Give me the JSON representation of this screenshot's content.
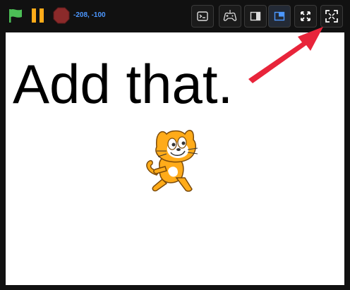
{
  "toolbar": {
    "green_flag_icon": "green-flag-icon",
    "pause_icon": "pause-icon",
    "stop_icon": "stop-sign-icon",
    "coords": "-208, -100",
    "buttons": [
      {
        "name": "addons-button",
        "icon": "terminal-icon"
      },
      {
        "name": "gamepad-button",
        "icon": "gamepad-icon"
      },
      {
        "name": "small-stage-button",
        "icon": "small-stage-icon"
      },
      {
        "name": "normal-stage-button",
        "icon": "normal-stage-icon"
      },
      {
        "name": "fullscreen-button",
        "icon": "fullscreen-icon"
      },
      {
        "name": "browser-fullscreen-button",
        "icon": "expand-icon"
      }
    ]
  },
  "stage": {
    "text": "Add that.",
    "sprite": "scratch-cat-sprite"
  },
  "colors": {
    "toolbar_bg": "#111111",
    "stage_bg": "#ffffff",
    "coords": "#4c97ff",
    "flag": "#4cbf56",
    "pause": "#ffab19",
    "stop": "#8b2a2a",
    "arrow": "#e8243a"
  }
}
